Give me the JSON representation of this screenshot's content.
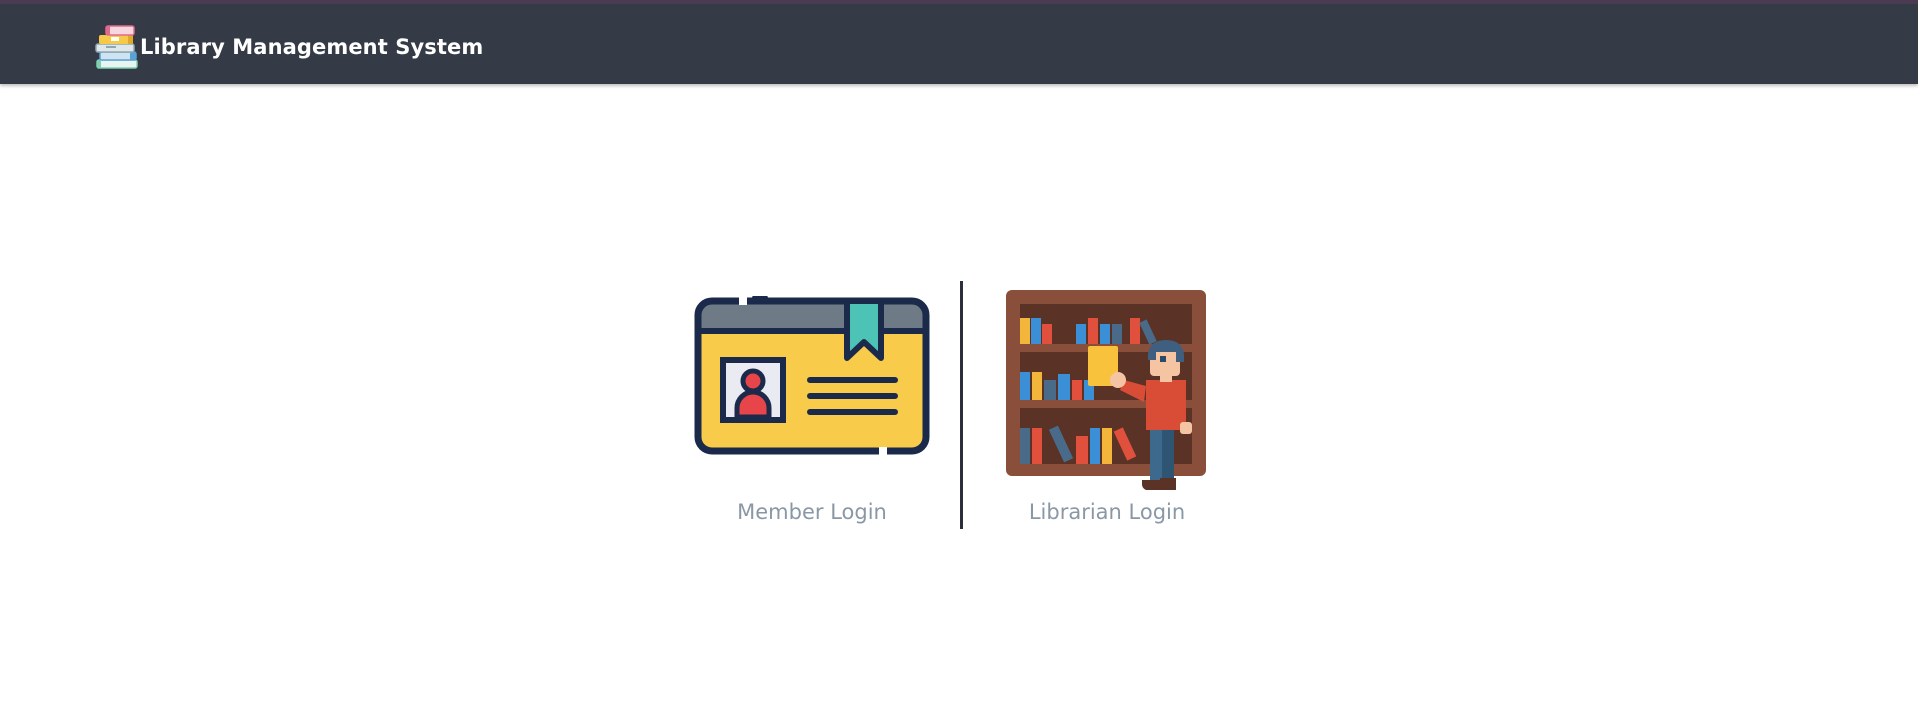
{
  "app": {
    "title": "Library Management System",
    "logo_icon": "stacked-books-icon"
  },
  "login_options": [
    {
      "label": "Member Login",
      "icon": "id-card-icon"
    },
    {
      "label": "Librarian Login",
      "icon": "librarian-bookshelf-icon"
    }
  ],
  "colors": {
    "navbar_bg": "#343a46",
    "label_text": "#8a98a6",
    "divider": "#2b2f3a",
    "card_yellow": "#f9cb4b",
    "card_outline": "#1b2a4a",
    "bookmark_teal": "#4cc3b4",
    "shelf_brown": "#8a4f3a",
    "shirt_red": "#d94d36"
  }
}
